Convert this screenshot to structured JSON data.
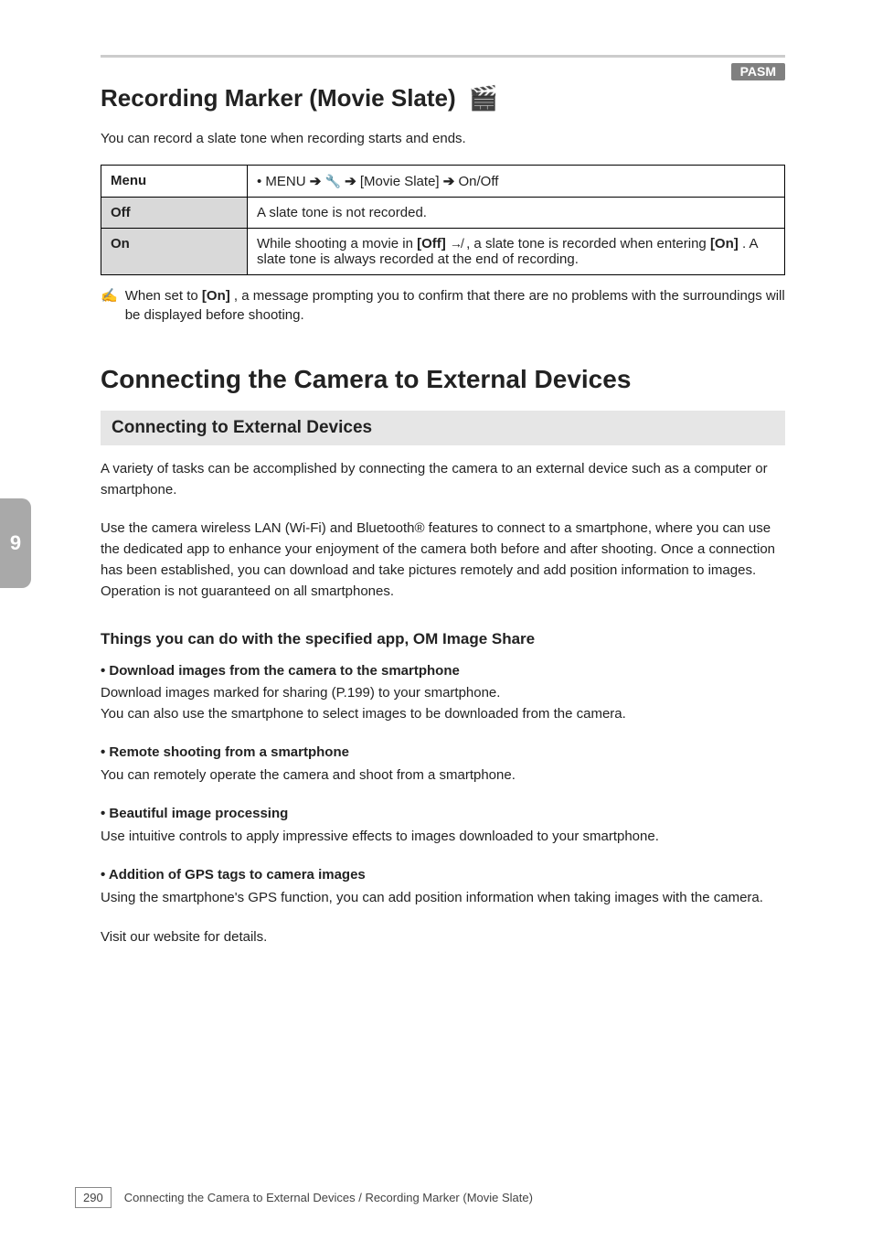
{
  "header": {
    "badge": "PASM",
    "title": "Recording Marker (Movie Slate)",
    "icon": "🎬"
  },
  "intro": "You can record a slate tone when recording starts and ends.",
  "table": {
    "menu_label": "Menu",
    "menu_path_prefix": "• MENU ",
    "menu_path_mid": " [Movie Slate] ",
    "menu_path_suffix": " On/Off",
    "wrench_icon": "🔧",
    "off_label": "Off",
    "off_desc": "A slate tone is not recorded.",
    "on_label": "On",
    "on_desc_1": "While shooting a movie in ",
    "on_desc_2": ", a slate tone is recorded when entering ",
    "on_desc_3": ". A slate tone is always recorded at the end of recording.",
    "on_off_bold": "[Off]",
    "on_on_bold": "[On]",
    "rec_icon": "↛"
  },
  "hint": {
    "icon": "✍",
    "text_1": "When set to ",
    "text_bold": "[On]",
    "text_2": ", a message prompting you to confirm that there are no problems with the surroundings will be displayed before shooting."
  },
  "h2": "Connecting the Camera to External Devices",
  "externals": {
    "bar": "Connecting to External Devices",
    "para1": "A variety of tasks can be accomplished by connecting the camera to an external device such as a computer or smartphone.",
    "para2": "Use the camera wireless LAN (Wi-Fi) and Bluetooth® features to connect to a smartphone, where you can use the dedicated app to enhance your enjoyment of the camera both before and after shooting. Once a connection has been established, you can download and take pictures remotely and add position information to images.",
    "para2_suffix": "Operation is not guaranteed on all smartphones.",
    "h3": "Things you can do with the specified app, OM Image Share",
    "features": [
      {
        "name": "Download images from the camera to the smartphone",
        "body": "Download images marked for sharing (P.199) to your smartphone.",
        "body2": "You can also use the smartphone to select images to be downloaded from the camera."
      },
      {
        "name": "Remote shooting from a smartphone",
        "body": "You can remotely operate the camera and shoot from a smartphone."
      },
      {
        "name": "Beautiful image processing",
        "body": "Use intuitive controls to apply impressive effects to images downloaded to your smartphone."
      },
      {
        "name": "Addition of GPS tags to camera images",
        "body": "Using the smartphone's GPS function, you can add position information when taking images with the camera."
      }
    ],
    "visit": "Visit our website for details."
  },
  "side_tab": "9",
  "footer": {
    "page": "290",
    "crumb": "Connecting the Camera to External Devices / Recording Marker (Movie Slate)"
  }
}
